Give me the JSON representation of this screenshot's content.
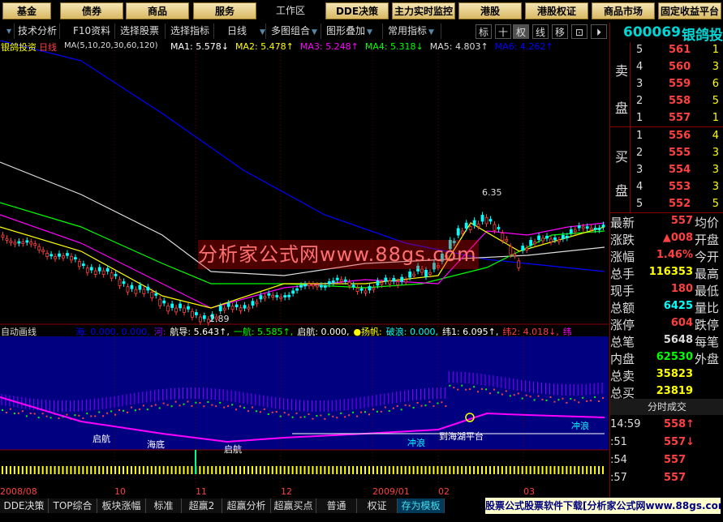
{
  "top_menu": {
    "buttons": [
      "基金",
      "债券",
      "商品",
      "服务",
      "工作区",
      "DDE决策",
      "主力实时监控",
      "港股",
      "港股权证",
      "商品市场",
      "固定收益平台"
    ]
  },
  "toolbar": {
    "items": [
      "技术分析",
      "F10资料",
      "选择股票",
      "选择指标",
      "日线",
      "多图组合",
      "图形叠加",
      "常用指标"
    ],
    "icons": [
      "标",
      "十",
      "权",
      "线",
      "移",
      "⊡",
      "⏵"
    ]
  },
  "chart": {
    "title": "银鸽投资",
    "period": "日线",
    "ma_label": "MA(5,10,20,30,60,120)",
    "ma": [
      {
        "name": "MA1:",
        "value": "5.578↓",
        "color": "#ffffff"
      },
      {
        "name": "MA2:",
        "value": "5.478↑",
        "color": "#ffff00"
      },
      {
        "name": "MA3:",
        "value": "5.248↑",
        "color": "#ff00ff"
      },
      {
        "name": "MA4:",
        "value": "5.318↓",
        "color": "#00ff00"
      },
      {
        "name": "MA5:",
        "value": "4.803↑",
        "color": "#dddddd"
      },
      {
        "name": "MA6:",
        "value": "4.262↑",
        "color": "#0000ff"
      }
    ],
    "high_label": "6.35",
    "low_label": "2.89",
    "watermark": "分析家公式网www.88gs.com"
  },
  "indicator": {
    "title": "自动画线",
    "params": [
      {
        "text": "海: 0.000, 0.000,",
        "color": "#0000ff"
      },
      {
        "text": "河:",
        "color": "#8800ff"
      },
      {
        "text": "航导: 5.643↑,",
        "color": "#ffffff"
      },
      {
        "text": "一航: 5.585↑,",
        "color": "#00ff00"
      },
      {
        "text": "启航: 0.000,",
        "color": "#ffffff"
      },
      {
        "text": "●扬帆:",
        "color": "#ffff00"
      },
      {
        "text": "破浪: 0.000,",
        "color": "#00ffff"
      },
      {
        "text": "纬1: 6.095↑,",
        "color": "#ffffff"
      },
      {
        "text": "纬2: 4.018↓,",
        "color": "#ff4040"
      },
      {
        "text": "纬",
        "color": "#ff00ff"
      }
    ],
    "annotations": [
      "启航",
      "海底",
      "启航",
      "冲浪",
      "到海湖平台",
      "冲浪"
    ]
  },
  "time_axis": [
    "2008/08",
    "10",
    "11",
    "12",
    "2009/01",
    "02",
    "03"
  ],
  "quote": {
    "code": "600069",
    "name": "银鸽投",
    "sell_side": "卖盘",
    "buy_side": "买盘",
    "asks": [
      {
        "level": "5",
        "price": "561",
        "vol": "1"
      },
      {
        "level": "4",
        "price": "560",
        "vol": "3"
      },
      {
        "level": "3",
        "price": "559",
        "vol": "6"
      },
      {
        "level": "2",
        "price": "558",
        "vol": "5"
      },
      {
        "level": "1",
        "price": "557",
        "vol": "1"
      }
    ],
    "bids": [
      {
        "level": "1",
        "price": "556",
        "vol": "4"
      },
      {
        "level": "2",
        "price": "555",
        "vol": "3"
      },
      {
        "level": "3",
        "price": "554",
        "vol": "3"
      },
      {
        "level": "4",
        "price": "553",
        "vol": "3"
      },
      {
        "level": "5",
        "price": "552",
        "vol": "5"
      }
    ],
    "stats": [
      {
        "k": "最新",
        "v": "557",
        "color": "#ff4040",
        "k2": "均价"
      },
      {
        "k": "涨跌",
        "v": "▲008",
        "color": "#ff4040",
        "k2": "开盘"
      },
      {
        "k": "涨幅",
        "v": "1.46%",
        "color": "#ff4040",
        "k2": "今开"
      },
      {
        "k": "总手",
        "v": "116353",
        "color": "#ffff00",
        "k2": "最高"
      },
      {
        "k": "现手",
        "v": "180",
        "color": "#ff4040",
        "k2": "最低"
      },
      {
        "k": "总额",
        "v": "6425",
        "color": "#00ffff",
        "k2": "量比"
      },
      {
        "k": "涨停",
        "v": "604",
        "color": "#ff4040",
        "k2": "跌停"
      },
      {
        "k": "总笔",
        "v": "5648",
        "color": "#dddddd",
        "k2": "每笔"
      },
      {
        "k": "内盘",
        "v": "62530",
        "color": "#00ff00",
        "k2": "外盘"
      },
      {
        "k": "总卖",
        "v": "35823",
        "color": "#ffff00",
        "k2": ""
      },
      {
        "k": "总买",
        "v": "23819",
        "color": "#ffff00",
        "k2": ""
      }
    ],
    "ticks_title": "分时成交",
    "ticks": [
      {
        "t": "14:59",
        "p": "558↑",
        "color": "#ff4040"
      },
      {
        "t": ":51",
        "p": "557↓",
        "color": "#ff4040"
      },
      {
        "t": ":54",
        "p": "557",
        "color": "#ff4040"
      },
      {
        "t": ":57",
        "p": "557",
        "color": "#ff4040"
      }
    ]
  },
  "bottom_tabs": [
    "DDE决策",
    "TOP综合",
    "板块涨幅",
    "标准",
    "超赢2",
    "超赢分析",
    "超赢买点",
    "普通",
    "权证",
    "存为模板"
  ],
  "active_tab": "存为模板",
  "ad_text": "股票公式股票软件下载[分析家公式网www.88gs.com]",
  "colors": {
    "up": "#ff4040",
    "down": "#00ffff",
    "accent": "#d8b863"
  }
}
